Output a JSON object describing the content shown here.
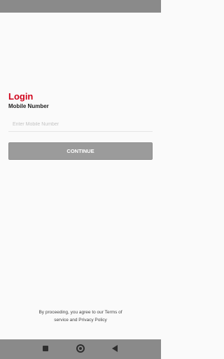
{
  "login": {
    "title": "Login",
    "mobile_label": "Mobile Number",
    "mobile_placeholder": "Enter Mobile Number",
    "mobile_value": "",
    "continue_label": "CONTINUE"
  },
  "footer": {
    "terms_line1": "By proceeding, you agree to our Terms of",
    "terms_line2": "service and Privacy Policy"
  },
  "system_nav": {
    "recents_icon": "square-icon",
    "home_icon": "circle-icon",
    "back_icon": "triangle-back-icon"
  },
  "colors": {
    "accent": "#d0021b",
    "button_disabled": "#9b9b9b",
    "bars": "#8a8a8a"
  }
}
